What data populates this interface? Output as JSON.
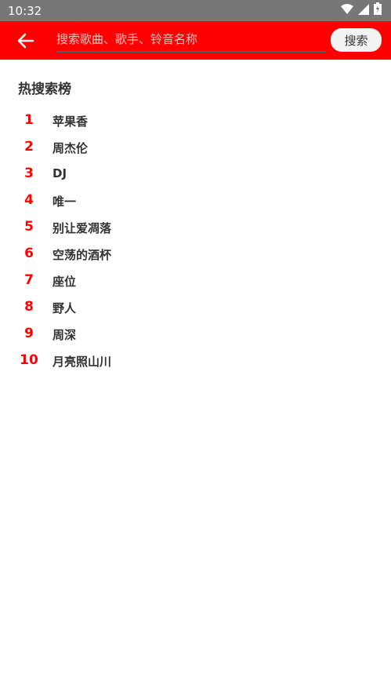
{
  "status_bar": {
    "time": "10:32",
    "icons": [
      "wifi-icon",
      "signal-icon",
      "battery-icon"
    ]
  },
  "header": {
    "back_icon": "arrow-left-icon",
    "search_placeholder": "搜索歌曲、歌手、铃音名称",
    "search_value": "",
    "search_button_label": "搜索"
  },
  "hot_search": {
    "title": "热搜索榜",
    "items": [
      {
        "rank": "1",
        "text": "苹果香"
      },
      {
        "rank": "2",
        "text": "周杰伦"
      },
      {
        "rank": "3",
        "text": "DJ"
      },
      {
        "rank": "4",
        "text": "唯一"
      },
      {
        "rank": "5",
        "text": "别让爱凋落"
      },
      {
        "rank": "6",
        "text": "空荡的酒杯"
      },
      {
        "rank": "7",
        "text": "座位"
      },
      {
        "rank": "8",
        "text": "野人"
      },
      {
        "rank": "9",
        "text": "周深"
      },
      {
        "rank": "10",
        "text": "月亮照山川"
      }
    ]
  },
  "colors": {
    "accent": "#ff0000",
    "status_bar": "#777777",
    "rank": "#ff0000",
    "text": "#333333"
  }
}
